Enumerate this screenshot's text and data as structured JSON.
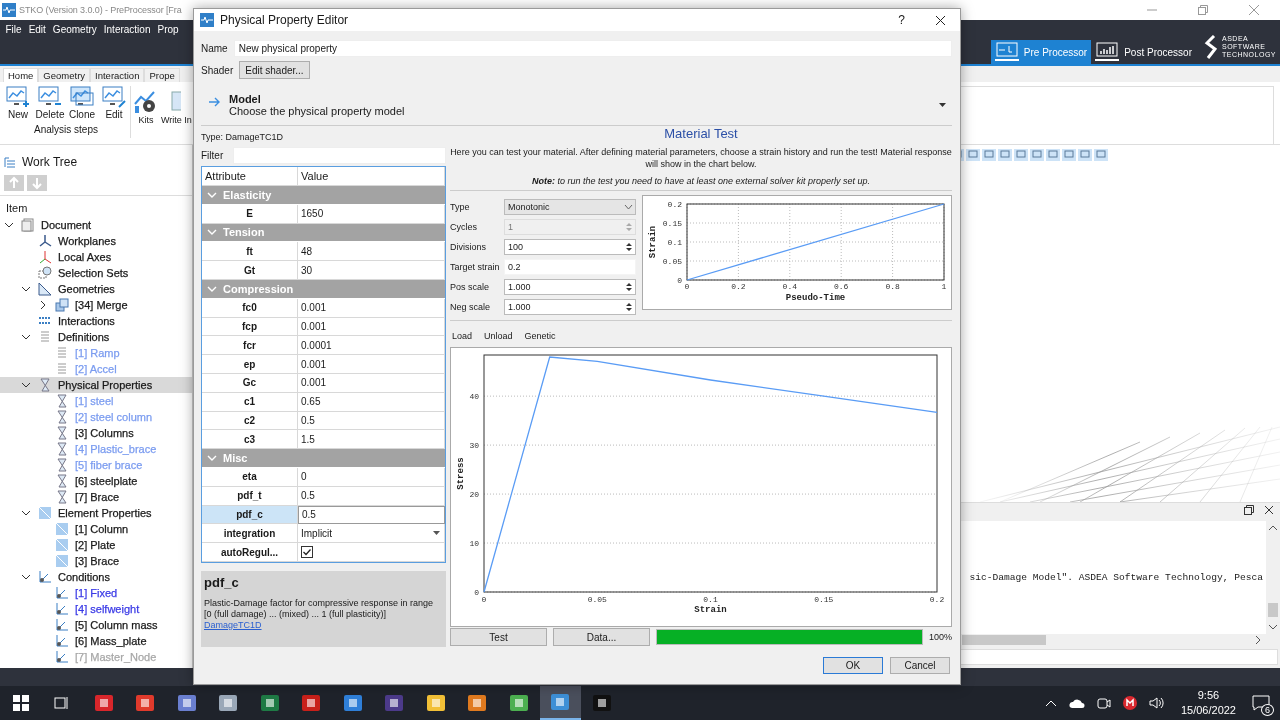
{
  "app": {
    "title": "STKO (Version 3.0.0) - PreProcessor [Fra",
    "menu": [
      "File",
      "Edit",
      "Geometry",
      "Interaction",
      "Prop"
    ],
    "modes": [
      {
        "label": "Pre Processor",
        "selected": true,
        "kind": "pre"
      },
      {
        "label": "Post Processor",
        "selected": false,
        "kind": "post"
      }
    ],
    "logo": [
      "ASDEA",
      "SOFTWARE",
      "TECHNOLOGY"
    ],
    "ribbon_tabs": [
      {
        "label": "Home",
        "selected": true
      },
      {
        "label": "Geometry",
        "selected": false
      },
      {
        "label": "Interaction",
        "selected": false
      },
      {
        "label": "Prope",
        "selected": false
      }
    ],
    "ribbon_group": {
      "label": "Analysis steps",
      "buttons": [
        {
          "label": "New",
          "kind": "new"
        },
        {
          "label": "Delete",
          "kind": "delete"
        },
        {
          "label": "Clone",
          "kind": "clone"
        },
        {
          "label": "Edit",
          "kind": "edit"
        }
      ]
    },
    "ribbon_buttons": [
      {
        "label": "Kits",
        "kind": "kits"
      },
      {
        "label": "Write In",
        "kind": "write"
      }
    ]
  },
  "work_tree": {
    "title": "Work Tree",
    "column": "Item",
    "items": [
      {
        "label": "Document",
        "kind": "document",
        "expanded": true,
        "selected": false,
        "color": "#1a1a1a",
        "children": [
          {
            "label": "Workplanes",
            "kind": "workplanes",
            "selected": false,
            "color": "#1a1a1a"
          },
          {
            "label": "Local Axes",
            "kind": "axes",
            "selected": false,
            "color": "#1a1a1a"
          },
          {
            "label": "Selection Sets",
            "kind": "selection",
            "selected": false,
            "color": "#1a1a1a"
          },
          {
            "label": "Geometries",
            "kind": "geometry",
            "expanded": true,
            "selected": false,
            "color": "#1a1a1a",
            "children": [
              {
                "label": "[34] Merge",
                "kind": "merge",
                "expanded": false,
                "selected": false,
                "color": "#1a1a1a"
              }
            ]
          },
          {
            "label": "Interactions",
            "kind": "interactions",
            "selected": false,
            "color": "#1a1a1a"
          },
          {
            "label": "Definitions",
            "kind": "definition",
            "expanded": true,
            "selected": false,
            "color": "#1a1a1a",
            "children": [
              {
                "label": "[1] Ramp",
                "kind": "definition",
                "selected": false,
                "color": "#7b9cf0"
              },
              {
                "label": "[2] Accel",
                "kind": "definition",
                "selected": false,
                "color": "#7b9cf0"
              }
            ]
          },
          {
            "label": "Physical Properties",
            "kind": "physical",
            "expanded": true,
            "selected": true,
            "color": "#1a1a1a",
            "children": [
              {
                "label": "[1] steel",
                "kind": "physical",
                "selected": false,
                "color": "#7b9cf0"
              },
              {
                "label": "[2] steel column",
                "kind": "physical",
                "selected": false,
                "color": "#7b9cf0"
              },
              {
                "label": "[3] Columns",
                "kind": "physical",
                "selected": false,
                "color": "#1a1a1a"
              },
              {
                "label": "[4] Plastic_brace",
                "kind": "physical",
                "selected": false,
                "color": "#7b9cf0"
              },
              {
                "label": "[5] fiber brace",
                "kind": "physical",
                "selected": false,
                "color": "#7b9cf0"
              },
              {
                "label": "[6] steelplate",
                "kind": "physical",
                "selected": false
              },
              {
                "label": "[7] Brace",
                "kind": "physical",
                "selected": false,
                "color": "#1a1a1a"
              }
            ]
          },
          {
            "label": "Element Properties",
            "kind": "element",
            "expanded": true,
            "selected": false,
            "color": "#1a1a1a",
            "children": [
              {
                "label": "[1] Column",
                "kind": "element",
                "selected": false,
                "color": "#1a1a1a"
              },
              {
                "label": "[2] Plate",
                "kind": "element",
                "selected": false,
                "color": "#1a1a1a"
              },
              {
                "label": "[3] Brace",
                "kind": "element",
                "selected": false,
                "color": "#1a1a1a"
              }
            ]
          },
          {
            "label": "Conditions",
            "kind": "condition",
            "expanded": true,
            "selected": false,
            "color": "#1a1a1a",
            "children": [
              {
                "label": "[1] Fixed",
                "kind": "condition",
                "selected": false,
                "color": "#3a3ae6"
              },
              {
                "label": "[4] selfweight",
                "kind": "condition",
                "selected": false,
                "color": "#3a3ae6"
              },
              {
                "label": "[5] Column mass",
                "kind": "condition",
                "selected": false,
                "color": "#1a1a1a"
              },
              {
                "label": "[6] Mass_plate",
                "kind": "condition",
                "selected": false
              },
              {
                "label": "[7] Master_Node",
                "kind": "condition",
                "selected": false,
                "color": "#a8a8a8"
              }
            ]
          }
        ]
      }
    ]
  },
  "console": {
    "line": "sic-Damage Model\". ASDEA Software Technology, Pesca"
  },
  "taskbar": {
    "apps": [
      {
        "kind": "start",
        "selected": false
      },
      {
        "kind": "taskview",
        "selected": false
      },
      {
        "kind": "red-grid",
        "selected": false
      },
      {
        "kind": "red-share",
        "selected": false
      },
      {
        "kind": "bird",
        "selected": false
      },
      {
        "kind": "drive",
        "selected": false
      },
      {
        "kind": "excel",
        "selected": false
      },
      {
        "kind": "pdf",
        "selected": false
      },
      {
        "kind": "photos",
        "selected": false
      },
      {
        "kind": "media",
        "selected": false
      },
      {
        "kind": "folder",
        "selected": false
      },
      {
        "kind": "matlab",
        "selected": false
      },
      {
        "kind": "chrome",
        "selected": false
      },
      {
        "kind": "stko",
        "selected": true
      },
      {
        "kind": "terminal",
        "selected": false
      }
    ],
    "time": "9:56",
    "date": "15/06/2022",
    "notifications": "6"
  },
  "dialog": {
    "title": "Physical Property Editor",
    "help": "?",
    "name_label": "Name",
    "name_value": "New physical property",
    "shader_label": "Shader",
    "shader_button": "Edit shader...",
    "model_title": "Model",
    "model_subtitle": "Choose the physical property model",
    "type": "Type:  DamageTC1D",
    "filter_label": "Filter",
    "columns": [
      "Attribute",
      "Value"
    ],
    "groups": [
      {
        "name": "Elasticity",
        "expanded": true,
        "rows": [
          {
            "attribute": "E",
            "value": "1650",
            "kind": "text",
            "selected": false
          }
        ]
      },
      {
        "name": "Tension",
        "expanded": true,
        "rows": [
          {
            "attribute": "ft",
            "value": "48",
            "kind": "text",
            "selected": false
          },
          {
            "attribute": "Gt",
            "value": "30",
            "kind": "text",
            "selected": false
          }
        ]
      },
      {
        "name": "Compression",
        "expanded": true,
        "rows": [
          {
            "attribute": "fc0",
            "value": "0.001",
            "kind": "text",
            "selected": false
          },
          {
            "attribute": "fcp",
            "value": "0.001",
            "kind": "text",
            "selected": false
          },
          {
            "attribute": "fcr",
            "value": "0.0001",
            "kind": "text",
            "selected": false
          },
          {
            "attribute": "ep",
            "value": "0.001",
            "kind": "text",
            "selected": false
          },
          {
            "attribute": "Gc",
            "value": "0.001",
            "kind": "text",
            "selected": false
          },
          {
            "attribute": "c1",
            "value": "0.65",
            "kind": "text",
            "selected": false
          },
          {
            "attribute": "c2",
            "value": "0.5",
            "kind": "text",
            "selected": false
          },
          {
            "attribute": "c3",
            "value": "1.5",
            "kind": "text",
            "selected": false
          }
        ]
      },
      {
        "name": "Misc",
        "expanded": true,
        "rows": [
          {
            "attribute": "eta",
            "value": "0",
            "kind": "text",
            "selected": false
          },
          {
            "attribute": "pdf_t",
            "value": "0.5",
            "kind": "text",
            "selected": false
          },
          {
            "attribute": "pdf_c",
            "value": "0.5",
            "kind": "text",
            "selected": true
          },
          {
            "attribute": "integration",
            "value": "Implicit",
            "kind": "dropdown",
            "selected": false
          },
          {
            "attribute": "autoRegul...",
            "kind": "checkbox",
            "checked": true,
            "selected": false
          }
        ]
      }
    ],
    "help_title": "pdf_c",
    "help_text": "Plastic-Damage factor for compressive response in range [0 (full damage) ... (mixed) ... 1 (full plasticity)]",
    "help_link": "DamageTC1D",
    "test_title": "Material Test",
    "test_intro": "Here you can test your material. After defining material parameters, choose a strain history and run the test! Material response will show in the chart below.",
    "test_note": "**Note:** to run the test you need to have at least one external solver kit properly set up.",
    "fields": [
      {
        "label": "Type",
        "value": "Monotonic",
        "kind": "select",
        "disabled": false
      },
      {
        "label": "Cycles",
        "value": "1",
        "kind": "spin",
        "disabled": true
      },
      {
        "label": "Divisions",
        "value": "100",
        "kind": "spin",
        "disabled": false
      },
      {
        "label": "Target strain",
        "value": "0.2",
        "kind": "text",
        "disabled": false
      },
      {
        "label": "Pos scale",
        "value": "1.000",
        "kind": "spin",
        "disabled": false
      },
      {
        "label": "Neg scale",
        "value": "1.000",
        "kind": "spin",
        "disabled": false
      }
    ],
    "history_chart": {
      "chart_data": {
        "type": "line",
        "xlabel": "Pseudo-Time",
        "ylabel": "Strain",
        "x": [
          0,
          1
        ],
        "grid": true,
        "series": [
          {
            "color": "#5a9cf5",
            "values": [
              0,
              0.2
            ]
          }
        ],
        "xlim": [
          0,
          1
        ],
        "ylim": [
          0,
          0.2
        ],
        "xticks": [
          0,
          0.2,
          0.4,
          0.6,
          0.8,
          1
        ],
        "yticks": [
          0,
          0.05,
          0.1,
          0.15,
          0.2
        ]
      }
    },
    "history_tabs": [
      "Load",
      "Unload",
      "Genetic"
    ],
    "response_chart": {
      "chart_data": {
        "type": "line",
        "xlabel": "Strain",
        "ylabel": "Stress",
        "x": [
          0,
          0.029,
          0.05,
          0.1,
          0.15,
          0.2
        ],
        "grid": true,
        "series": [
          {
            "color": "#5a9cf5",
            "values": [
              0,
              48,
              47.1,
              43.3,
              40,
              36.7
            ]
          }
        ],
        "xlim": [
          0,
          0.2
        ],
        "ylim": [
          0,
          48.4
        ],
        "xticks": [
          0,
          0.05,
          0.1,
          0.15,
          0.2
        ],
        "yticks": [
          0,
          10,
          20,
          30,
          40
        ]
      }
    },
    "test_button": "Test",
    "data_button": "Data...",
    "progress": {
      "level": 1,
      "label": "100%"
    },
    "ok": "OK",
    "cancel": "Cancel"
  }
}
